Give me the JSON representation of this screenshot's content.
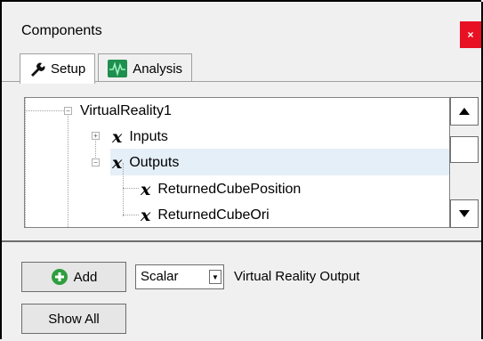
{
  "window": {
    "title": "Components",
    "close_label": "×"
  },
  "tabs": [
    {
      "label": "Setup",
      "icon": "wrench-icon",
      "active": true
    },
    {
      "label": "Analysis",
      "icon": "waveform-icon",
      "active": false
    }
  ],
  "tree": {
    "root": "VirtualReality1",
    "items": [
      {
        "label": "Inputs",
        "icon": "x-variable-icon",
        "expander": "+"
      },
      {
        "label": "Outputs",
        "icon": "x-variable-icon",
        "expander": "−",
        "selected": true
      },
      {
        "label": "ReturnedCubePosition",
        "icon": "x-variable-icon"
      },
      {
        "label": "ReturnedCubeOri",
        "icon": "x-variable-icon"
      }
    ]
  },
  "bottom": {
    "add_label": "Add",
    "type_value": "Scalar",
    "output_label": "Virtual Reality Output",
    "show_all_label": "Show All"
  },
  "colors": {
    "close_red": "#e81123",
    "selection": "#e5eff8",
    "add_green": "#2e9e3e"
  }
}
